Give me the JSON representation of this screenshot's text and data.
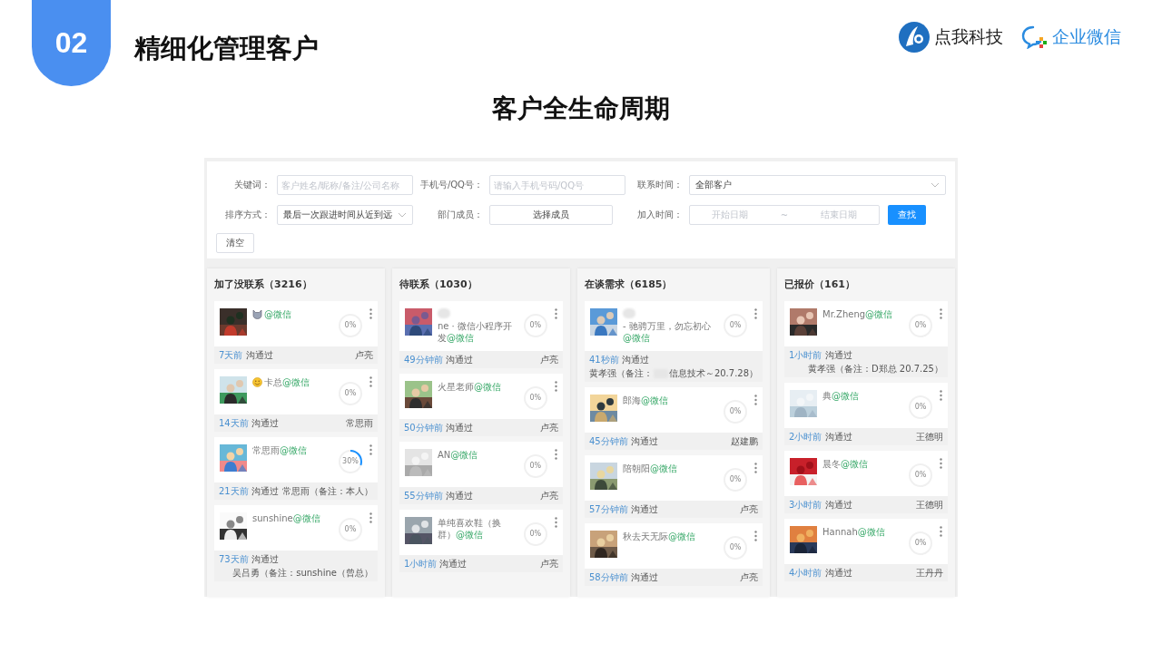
{
  "slide": {
    "number": "02",
    "title": "精细化管理客户",
    "brand": "点我科技",
    "partner": "企业微信",
    "heading": "客户全生命周期"
  },
  "filters": [
    {
      "kind": "input",
      "label": "关键词：",
      "placeholder": "客户姓名/昵称/备注/公司名称"
    },
    {
      "kind": "input",
      "label": "手机号/QQ号：",
      "placeholder": "请输入手机号码/QQ号"
    },
    {
      "kind": "select",
      "label": "联系时间：",
      "value": "全部客户"
    },
    {
      "kind": "select",
      "label": "排序方式：",
      "value": "最后一次跟进时间从近到远"
    },
    {
      "kind": "picker",
      "label": "部门成员：",
      "value": "选择成员"
    },
    {
      "kind": "daterange",
      "label": "加入时间：",
      "start_placeholder": "开始日期",
      "separator": "~",
      "end_placeholder": "结束日期"
    }
  ],
  "search_button": "查找",
  "clear_button": "清空",
  "columns": [
    {
      "title": "加了没联系（3216）",
      "cards": [
        {
          "kind": "emoji_only",
          "wechat": "@微信",
          "progress": "0%",
          "time": "7天前",
          "status": "沟通过",
          "owner": "卢亮"
        },
        {
          "kind": "emoji_after",
          "name": "卡总",
          "wechat": "@微信",
          "progress": "0%",
          "time": "14天前",
          "status": "沟通过",
          "owner": "常思雨"
        },
        {
          "kind": "plain",
          "name": "常思雨",
          "wechat": "@微信",
          "progress": "30%",
          "time": "21天前",
          "status": "沟通过",
          "owner": "常思雨（备注：本人）"
        },
        {
          "kind": "plain",
          "name": "sunshine",
          "wechat": "@微信",
          "progress": "0%",
          "time": "73天前",
          "status": "沟通过",
          "owner": "吴吕勇（备注：sunshine（曾总）"
        }
      ]
    },
    {
      "title": "待联系（1030）",
      "cards": [
        {
          "kind": "blurred",
          "name": "ne · 微信小程序开发",
          "wechat": "@微信",
          "progress": "0%",
          "time": "49分钟前",
          "status": "沟通过",
          "owner": "卢亮"
        },
        {
          "kind": "plain",
          "name": "火星老师",
          "wechat": "@微信",
          "progress": "0%",
          "time": "50分钟前",
          "status": "沟通过",
          "owner": "卢亮"
        },
        {
          "kind": "plain",
          "name": "AN",
          "wechat": "@微信",
          "progress": "0%",
          "time": "55分钟前",
          "status": "沟通过",
          "owner": "卢亮"
        },
        {
          "kind": "plain",
          "name": "单纯喜欢鞋（换群）",
          "wechat": "@微信",
          "progress": "0%",
          "time": "1小时前",
          "status": "沟通过",
          "owner": "卢亮"
        }
      ]
    },
    {
      "title": "在谈需求（6185）",
      "cards": [
        {
          "kind": "blurred",
          "name": "- 驰骋万里，勿忘初心",
          "wechat": "@微信",
          "progress": "0%",
          "time": "41秒前",
          "status": "沟通过",
          "owner": "黄孝强（备注：",
          "owner_tail": "信息技术～20.7.28）"
        },
        {
          "kind": "plain",
          "name": "郎海",
          "wechat": "@微信",
          "progress": "0%",
          "time": "45分钟前",
          "status": "沟通过",
          "owner": "赵建鹏"
        },
        {
          "kind": "plain",
          "name": "陪朝阳",
          "wechat": "@微信",
          "progress": "0%",
          "time": "57分钟前",
          "status": "沟通过",
          "owner": "卢亮"
        },
        {
          "kind": "plain",
          "name": "秋去天无际",
          "wechat": "@微信",
          "progress": "0%",
          "time": "58分钟前",
          "status": "沟通过",
          "owner": "卢亮"
        }
      ]
    },
    {
      "title": "已报价（161）",
      "cards": [
        {
          "kind": "plain",
          "name": "Mr.Zheng",
          "wechat": "@微信",
          "progress": "0%",
          "time": "1小时前",
          "status": "沟通过",
          "owner": "黄孝强（备注：D郑总 20.7.25）"
        },
        {
          "kind": "plain",
          "name": "典",
          "wechat": "@微信",
          "progress": "0%",
          "time": "2小时前",
          "status": "沟通过",
          "owner": "王德明"
        },
        {
          "kind": "plain",
          "name": "晨冬",
          "wechat": "@微信",
          "progress": "0%",
          "time": "3小时前",
          "status": "沟通过",
          "owner": "王德明"
        },
        {
          "kind": "plain",
          "name": "Hannah",
          "wechat": "@微信",
          "progress": "0%",
          "time": "4小时前",
          "status": "沟通过",
          "owner": "王丹丹"
        }
      ]
    }
  ]
}
